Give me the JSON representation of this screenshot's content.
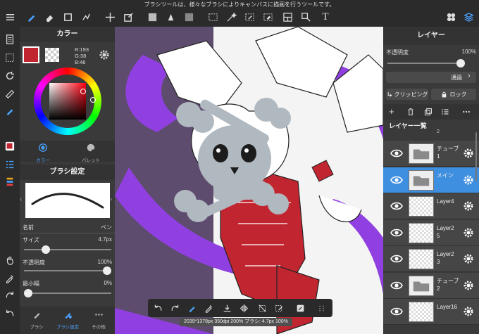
{
  "topbar": {
    "hint": "ブラシツールは、様々なブラシによりキャンバスに描画を行うツールです。",
    "text_tool": "T"
  },
  "color_panel": {
    "title": "カラー",
    "rgb_r": "R:193",
    "rgb_g": "G:38",
    "rgb_b": "B:48",
    "tab_color": "カラー",
    "tab_palette": "パレット",
    "main_color": "#c12630"
  },
  "brush_panel": {
    "title": "ブラシ設定",
    "name_label": "名前",
    "name_value": "ペン",
    "size_label": "サイズ",
    "size_value": "4.7px",
    "size_level": 0.22,
    "opacity_label": "不透明度",
    "opacity_value": "100%",
    "opacity_level": 1.0,
    "min_width_label": "最小幅",
    "min_width_value": "0%",
    "min_width_level": 0.0,
    "tabs": [
      "ブラシ",
      "ブラシ設定",
      "その他"
    ]
  },
  "layer_panel": {
    "title": "レイヤー",
    "opacity_label": "不透明度",
    "opacity_value": "100%",
    "opacity_level": 1.0,
    "blend_mode": "通過",
    "clipping_label": "クリッピング",
    "lock_label": "ロック",
    "list_title": "レイヤー一覧",
    "partial_top_label": "2",
    "layers": [
      {
        "name": "チューブ\n1",
        "type": "folder",
        "selected": false
      },
      {
        "name": "メイン",
        "type": "folder",
        "selected": true
      },
      {
        "name": "Layer4",
        "type": "raster",
        "selected": false
      },
      {
        "name": "Layer2\n5",
        "type": "raster",
        "selected": false
      },
      {
        "name": "Layer2\n3",
        "type": "raster",
        "selected": false
      },
      {
        "name": "チューブ\n2",
        "type": "folder",
        "selected": false
      },
      {
        "name": "Layer16",
        "type": "raster",
        "selected": false
      }
    ]
  },
  "status": "2039*1378px 350dpi 200% ブラシ: 4.7px 100%"
}
